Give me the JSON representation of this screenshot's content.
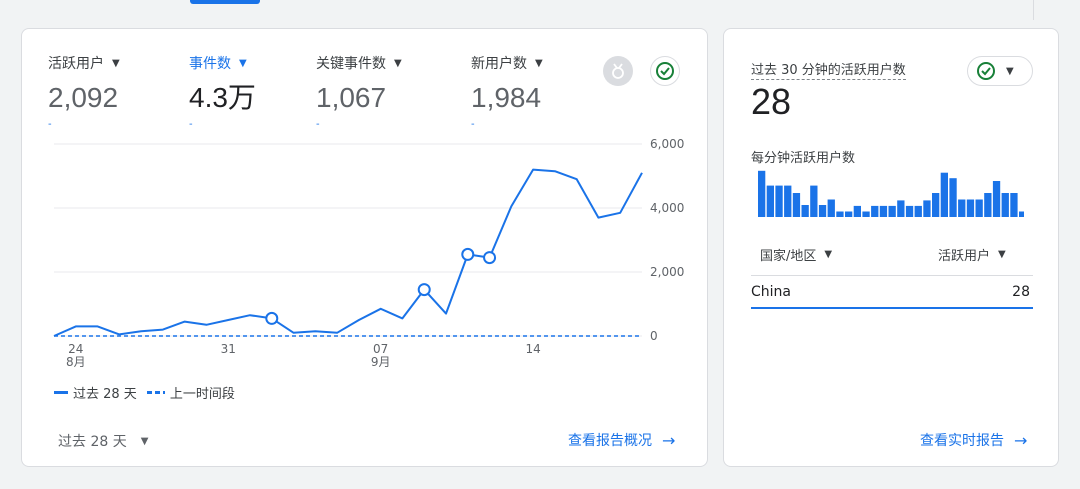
{
  "colors": {
    "accent": "#1a73e8",
    "grid": "#e8eaed",
    "text_muted": "#5f6368",
    "success": "#188038"
  },
  "overview": {
    "metrics": [
      {
        "label": "活跃用户",
        "value": "2,092",
        "sub": "-",
        "active": false
      },
      {
        "label": "事件数",
        "value": "4.3万",
        "sub": "-",
        "active": true
      },
      {
        "label": "关键事件数",
        "value": "1,067",
        "sub": "-",
        "active": false
      },
      {
        "label": "新用户数",
        "value": "1,984",
        "sub": "-",
        "active": false
      }
    ],
    "icons": {
      "insights": "medal-icon",
      "status": "check-circle-icon"
    },
    "legend": {
      "current": "过去 28 天",
      "previous": "上一时间段"
    },
    "date_range": "过去 28 天",
    "link": "查看报告概况",
    "link_icon": "arrow-right-icon"
  },
  "chart_data": {
    "type": "line",
    "x_ticks": [
      "24",
      "31",
      "07",
      "14"
    ],
    "x_tick_sub": [
      "8月",
      "",
      "9月",
      ""
    ],
    "y_ticks": [
      "6,000",
      "4,000",
      "2,000",
      "0"
    ],
    "ylim": [
      0,
      6000
    ],
    "series": [
      {
        "name": "过去 28 天",
        "style": "solid",
        "values": [
          0,
          300,
          300,
          50,
          150,
          200,
          450,
          350,
          500,
          650,
          550,
          100,
          150,
          100,
          500,
          850,
          550,
          1450,
          700,
          2550,
          2450,
          4050,
          5200,
          5150,
          4900,
          3700,
          3850,
          5100
        ]
      },
      {
        "name": "上一时间段",
        "style": "dashed",
        "values": [
          0,
          0,
          0,
          0,
          0,
          0,
          0,
          0,
          0,
          0,
          0,
          0,
          0,
          0,
          0,
          0,
          0,
          0,
          0,
          0,
          0,
          0,
          0,
          0,
          0,
          0,
          0,
          0
        ]
      }
    ],
    "annotations_at_index": [
      10,
      17,
      19,
      20
    ]
  },
  "realtime": {
    "title": "过去 30 分钟的活跃用户数",
    "value": "28",
    "status_icon": "check-circle-icon",
    "per_minute_label": "每分钟活跃用户数",
    "per_minute_bars": [
      5,
      3.4,
      3.4,
      3.4,
      2.6,
      1.3,
      3.4,
      1.3,
      1.9,
      0.6,
      0.6,
      1.2,
      0.6,
      1.2,
      1.2,
      1.2,
      1.8,
      1.2,
      1.2,
      1.8,
      2.6,
      4.8,
      4.2,
      1.9,
      1.9,
      1.9,
      2.6,
      3.9,
      2.6,
      2.6,
      0.6
    ],
    "table": {
      "headers": [
        "国家/地区",
        "活跃用户"
      ],
      "rows": [
        {
          "label": "China",
          "value": "28"
        }
      ]
    },
    "link": "查看实时报告",
    "link_icon": "arrow-right-icon"
  }
}
